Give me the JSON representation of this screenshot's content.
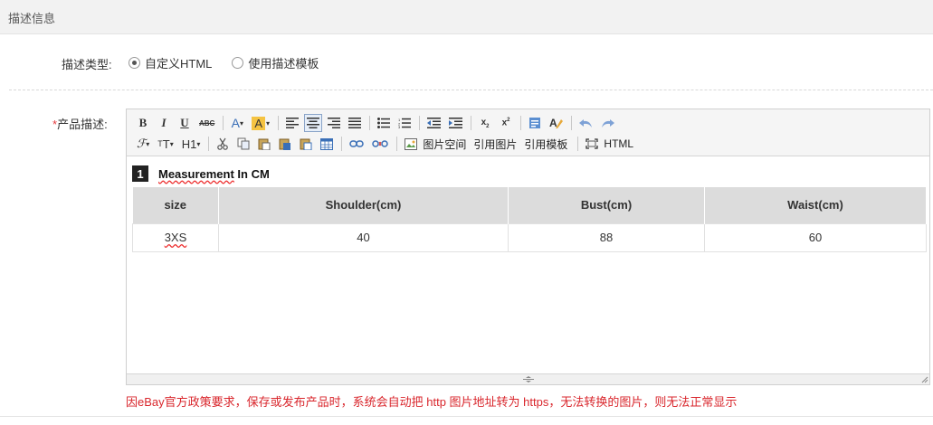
{
  "section": {
    "title": "描述信息"
  },
  "desc_type": {
    "label": "描述类型:",
    "options": [
      {
        "label": "自定义HTML",
        "checked": true
      },
      {
        "label": "使用描述模板",
        "checked": false
      }
    ]
  },
  "product_desc": {
    "required_mark": "*",
    "label": "产品描述:"
  },
  "toolbar": {
    "row1": [
      "bold",
      "italic",
      "underline",
      "strikethrough",
      "font-color",
      "highlight-color",
      "align-left",
      "align-center",
      "align-right",
      "justify",
      "bullet-list",
      "numbered-list",
      "outdent",
      "indent",
      "subscript",
      "superscript",
      "paste-text",
      "clear-format",
      "undo",
      "redo"
    ],
    "row2_text": {
      "image_space": "图片空间",
      "ref_image": "引用图片",
      "ref_template": "引用模板",
      "html": "HTML",
      "heading": "H1"
    }
  },
  "content": {
    "badge": "1",
    "heading_word1": "Measurement",
    "heading_rest": " In CM",
    "table": {
      "headers": [
        "size",
        "Shoulder(cm)",
        "Bust(cm)",
        "Waist(cm)"
      ],
      "rows": [
        [
          "3XS",
          "40",
          "88",
          "60"
        ]
      ]
    }
  },
  "notice": "因eBay官方政策要求，保存或发布产品时，系统会自动把 http 图片地址转为 https，无法转换的图片，则无法正常显示",
  "colors": {
    "notice": "#d9262c",
    "required": "#e4393c",
    "toolbar_bg": "#f5f5f5",
    "table_header_bg": "#dcdcdc"
  }
}
